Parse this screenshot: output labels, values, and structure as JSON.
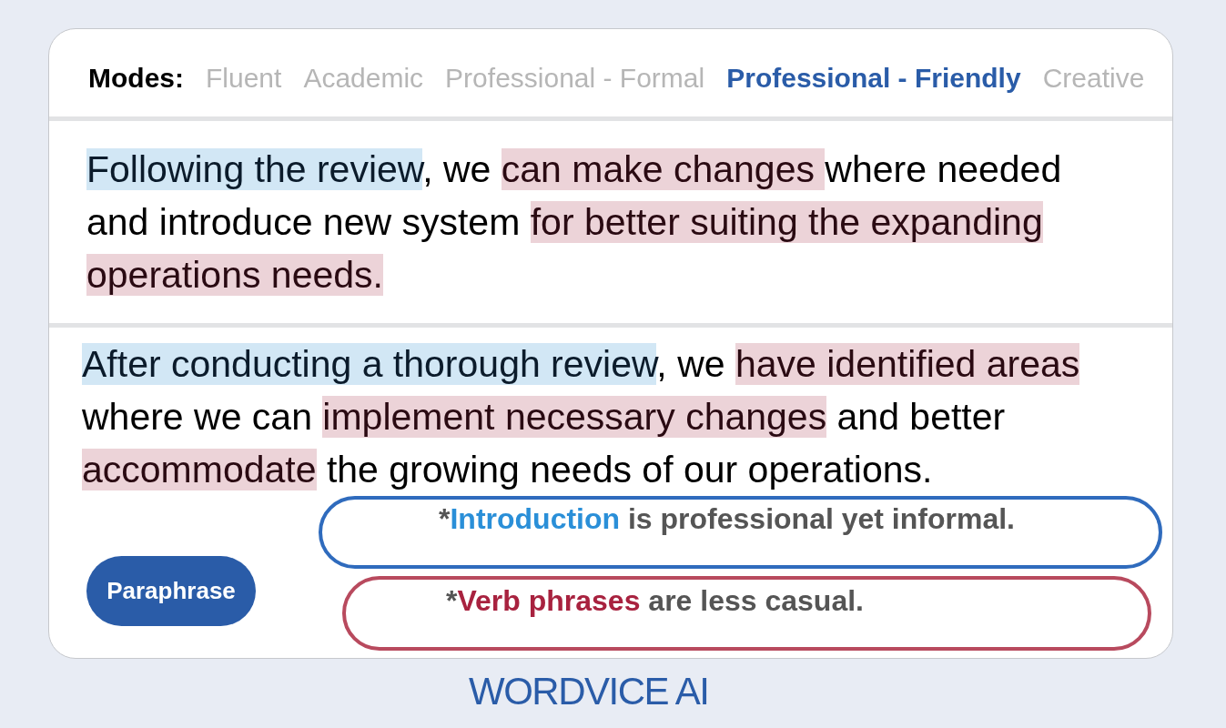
{
  "modes": {
    "label": "Modes:",
    "items": [
      {
        "label": "Fluent",
        "selected": false
      },
      {
        "label": "Academic",
        "selected": false
      },
      {
        "label": "Professional - Formal",
        "selected": false
      },
      {
        "label": "Professional - Friendly",
        "selected": true
      },
      {
        "label": "Creative",
        "selected": false
      }
    ]
  },
  "source": {
    "segments": [
      {
        "text": "Following the review",
        "kind": "introduction"
      },
      {
        "text": ", we ",
        "kind": "plain"
      },
      {
        "text": "can make changes ",
        "kind": "verb"
      },
      {
        "text": "where needed and introduce new system ",
        "kind": "plain"
      },
      {
        "text": "for better suiting the expanding operations needs.",
        "kind": "verb"
      }
    ]
  },
  "paraphrase": {
    "segments": [
      {
        "text": "After conducting a thorough review",
        "kind": "introduction"
      },
      {
        "text": ", we ",
        "kind": "plain"
      },
      {
        "text": "have identified areas",
        "kind": "verb"
      },
      {
        "text": " where we can ",
        "kind": "plain"
      },
      {
        "text": "implement necessary changes",
        "kind": "verb"
      },
      {
        "text": " and better ",
        "kind": "plain"
      },
      {
        "text": "accommodate",
        "kind": "verb"
      },
      {
        "text": " the growing needs of our operations.",
        "kind": "plain"
      }
    ]
  },
  "paraphrase_button": {
    "label": "Paraphrase"
  },
  "notes": [
    {
      "kind": "introduction",
      "color": "#2f6bbd",
      "segments": [
        {
          "text": "*",
          "emphasis": false
        },
        {
          "text": "Introduction",
          "emphasis": true
        },
        {
          "text": " is professional yet informal.",
          "emphasis": false
        }
      ]
    },
    {
      "kind": "verb",
      "color": "#b84a5e",
      "segments": [
        {
          "text": "*",
          "emphasis": false
        },
        {
          "text": "Verb phrases",
          "emphasis": true
        },
        {
          "text": " are less casual.",
          "emphasis": false
        }
      ]
    }
  ],
  "logo": {
    "text": "WORDVICE AI"
  }
}
